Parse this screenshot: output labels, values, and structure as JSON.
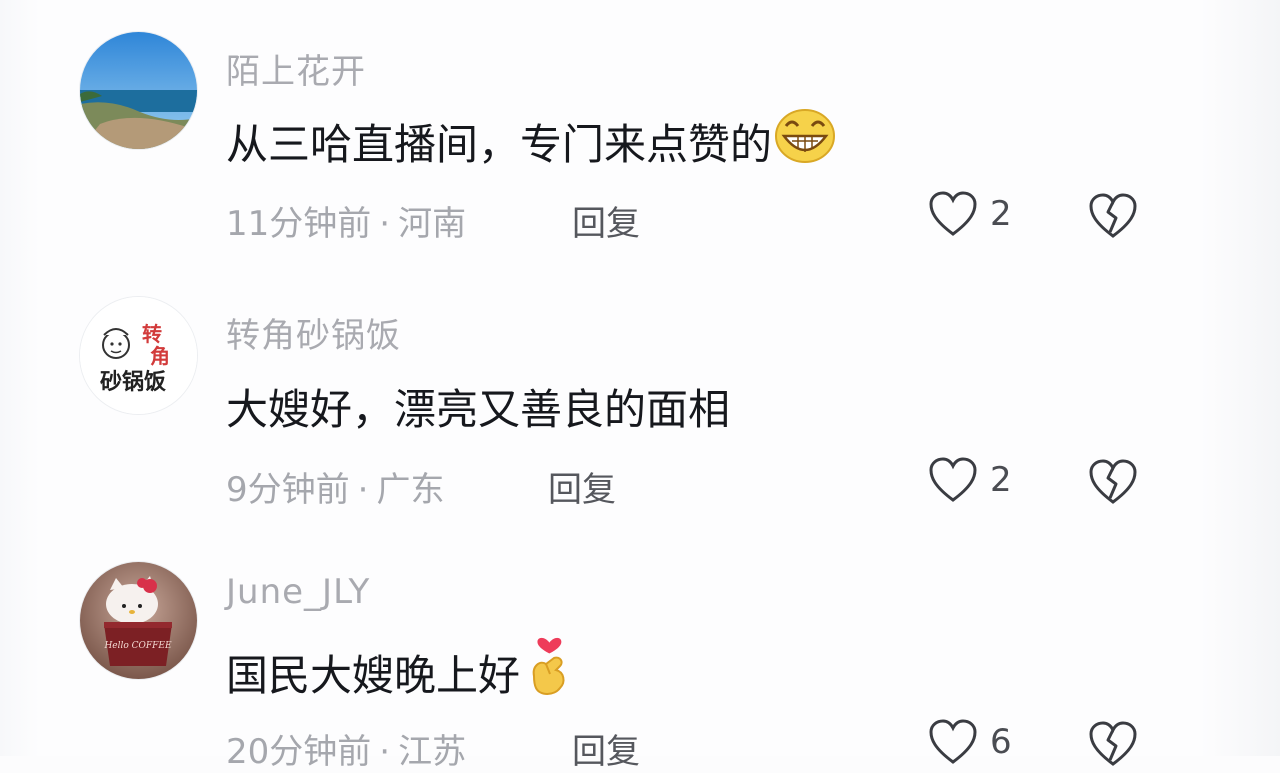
{
  "comments": [
    {
      "username": "陌上花开",
      "text": "从三哈直播间，专门来点赞的",
      "emoji": "grinning-face-icon",
      "time": "11分钟前",
      "location": "河南",
      "reply_label": "回复",
      "likes": "2"
    },
    {
      "username": "转角砂锅饭",
      "text": "大嫂好，漂亮又善良的面相",
      "time": "9分钟前",
      "location": "广东",
      "reply_label": "回复",
      "likes": "2",
      "avatar_text": "转角砂锅饭",
      "avatar_text_parts": {
        "top1": "转",
        "top2": "角",
        "bottom": "砂锅饭"
      }
    },
    {
      "username": "June_JLY",
      "text": "国民大嫂晚上好",
      "emoji": "finger-heart-icon",
      "time": "20分钟前",
      "location": "江苏",
      "reply_label": "回复",
      "likes": "6",
      "avatar_text": "Hello COFFEE"
    }
  ],
  "meta_separator": "·",
  "colors": {
    "username": "#a9aab0",
    "content": "#16181d",
    "meta": "#a5a7ad",
    "reply": "#55575d",
    "icon": "#3a3c42",
    "avatar_brand_red": "#d23b3b"
  }
}
